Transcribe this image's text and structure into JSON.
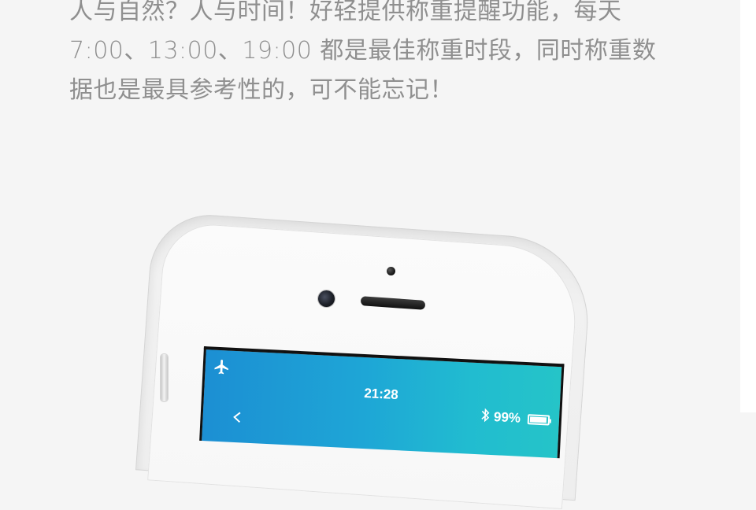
{
  "intro": {
    "lines": [
      "人与自然？人与时间！好轻提供称重提醒功能，每天",
      "7:00、13:00、19:00 都是最佳称重时段，同时称重数",
      "据也是最具参考性的，可不能忘记！"
    ]
  },
  "phone_status_bar": {
    "time": "21:28",
    "battery": "99%",
    "icons": [
      "airplane-icon",
      "bluetooth-icon",
      "battery-icon",
      "back-chevron-icon"
    ]
  },
  "colors": {
    "background": "#f5f5f5",
    "text": "#8f8f8f",
    "screen_gradient_start": "#1c8fd3",
    "screen_gradient_end": "#25c4c8"
  }
}
